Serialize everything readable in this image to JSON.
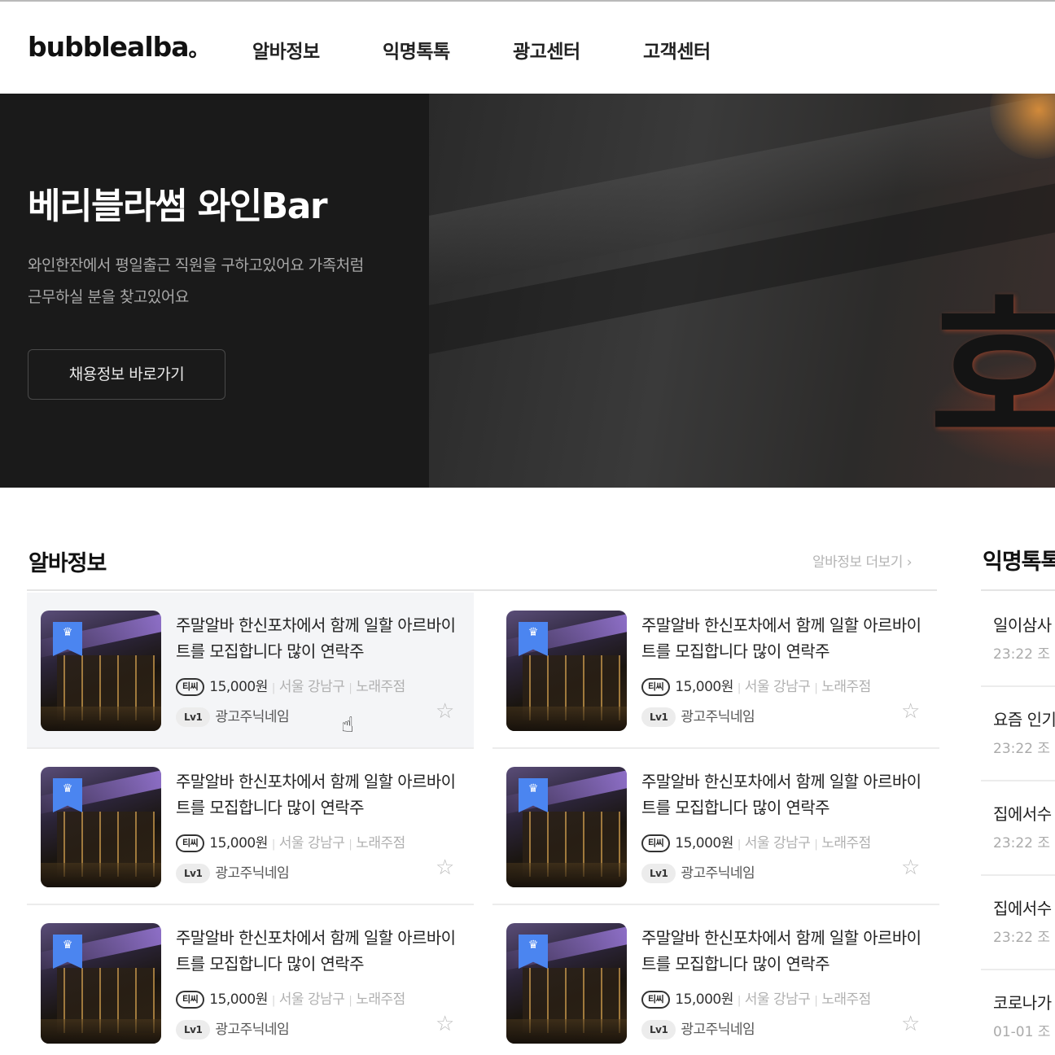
{
  "header": {
    "logo": "bubblealba",
    "logo_dot": "。",
    "nav": [
      "알바정보",
      "익명톡톡",
      "광고센터",
      "고객센터"
    ]
  },
  "hero": {
    "title": "베리블라썸 와인Bar",
    "desc_line1": "와인한잔에서 평일출근 직원을 구하고있어요 가족처럼",
    "desc_line2": "근무하실 분을 찾고있어요",
    "button": "채용정보 바로가기",
    "sign_char": "호"
  },
  "jobs": {
    "title": "알바정보",
    "more": "알바정보 더보기 ›",
    "cards": [
      {
        "title": "주말알바 한신포차에서 함께 일할 아르바이트를 모집합니다 많이 연락주",
        "pay_tag": "티씨",
        "pay": "15,000원",
        "region": "서울 강남구",
        "category": "노래주점",
        "level": "Lv1",
        "advertiser": "광고주닉네임"
      },
      {
        "title": "주말알바 한신포차에서 함께 일할 아르바이트를 모집합니다 많이 연락주",
        "pay_tag": "티씨",
        "pay": "15,000원",
        "region": "서울 강남구",
        "category": "노래주점",
        "level": "Lv1",
        "advertiser": "광고주닉네임"
      },
      {
        "title": "주말알바 한신포차에서 함께 일할 아르바이트를 모집합니다 많이 연락주",
        "pay_tag": "티씨",
        "pay": "15,000원",
        "region": "서울 강남구",
        "category": "노래주점",
        "level": "Lv1",
        "advertiser": "광고주닉네임"
      },
      {
        "title": "주말알바 한신포차에서 함께 일할 아르바이트를 모집합니다 많이 연락주",
        "pay_tag": "티씨",
        "pay": "15,000원",
        "region": "서울 강남구",
        "category": "노래주점",
        "level": "Lv1",
        "advertiser": "광고주닉네임"
      },
      {
        "title": "주말알바 한신포차에서 함께 일할 아르바이트를 모집합니다 많이 연락주",
        "pay_tag": "티씨",
        "pay": "15,000원",
        "region": "서울 강남구",
        "category": "노래주점",
        "level": "Lv1",
        "advertiser": "광고주닉네임"
      },
      {
        "title": "주말알바 한신포차에서 함께 일할 아르바이트를 모집합니다 많이 연락주",
        "pay_tag": "티씨",
        "pay": "15,000원",
        "region": "서울 강남구",
        "category": "노래주점",
        "level": "Lv1",
        "advertiser": "광고주닉네임"
      }
    ]
  },
  "talk": {
    "title": "익명톡톡",
    "items": [
      {
        "title": "일이삼사",
        "date": "23:22 조"
      },
      {
        "title": "요즘 인기",
        "date": "23:22 조"
      },
      {
        "title": "집에서수",
        "date": "23:22 조"
      },
      {
        "title": "집에서수",
        "date": "23:22 조"
      },
      {
        "title": "코로나가",
        "date": "01-01 조"
      }
    ]
  },
  "icons": {
    "badge": "crown-badge-icon",
    "star": "star-outline-icon",
    "cursor": "hand-pointer-icon"
  },
  "colors": {
    "accent_blue": "#4b85f0",
    "hero_bg": "#1a1a1a"
  }
}
